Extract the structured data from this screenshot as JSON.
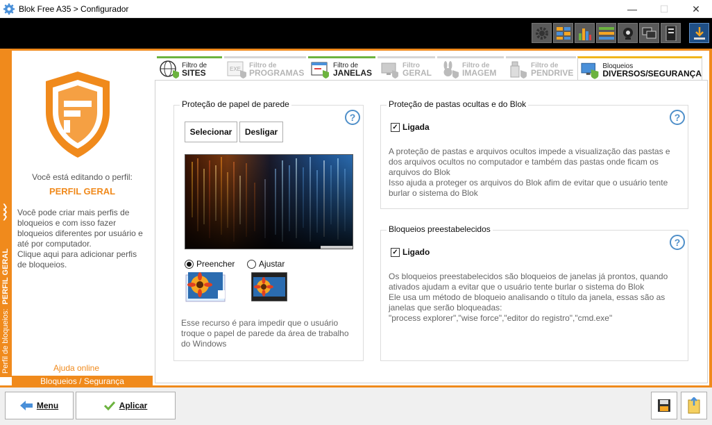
{
  "window": {
    "title": "Blok Free A35 > Configurador",
    "minimize": "—",
    "maximize": "☐",
    "close": "✕"
  },
  "toolbar": {
    "icons": [
      "settings-gear-icon",
      "grid-icon",
      "bar-chart-icon",
      "list-icon",
      "webcam-icon",
      "chat-icon",
      "device-icon",
      "download-icon"
    ]
  },
  "sidebar": {
    "vertical_label": "Perfil de bloqueios:",
    "vertical_profile": "PERFIL GERAL",
    "chevrons": "❯\n❯\n❯",
    "edit_label": "Você está editando o perfil:",
    "profile_name": "PERFIL GERAL",
    "description": "Você pode criar mais perfis de\nbloqueios e com isso fazer\nbloqueios diferentes por usuário e\naté por computador.\nClique aqui para adicionar perfis\nde bloqueios.",
    "help_online": "Ajuda online",
    "bottom_tab": "Bloqueios / Segurança"
  },
  "tabs": [
    {
      "small": "Filtro de",
      "big": "SITES"
    },
    {
      "small": "Filtro de",
      "big": "PROGRAMAS"
    },
    {
      "small": "Filtro de",
      "big": "JANELAS"
    },
    {
      "small": "Filtro",
      "big": "GERAL"
    },
    {
      "small": "Filtro de",
      "big": "IMAGEM"
    },
    {
      "small": "Filtro de",
      "big": "PENDRIVE"
    },
    {
      "small": "Bloqueios",
      "big": "DIVERSOS/SEGURANÇA"
    }
  ],
  "wallpaper": {
    "title": "Proteção de papel de parede",
    "help": "?",
    "select_label": "Selecionar",
    "disable_label": "Desligar",
    "fill_label": "Preencher",
    "fit_label": "Ajustar",
    "selected_mode": "Preencher",
    "note": "Esse recurso é para impedir que o usuário\ntroque o papel de parede da área de trabalho\ndo Windows"
  },
  "hidden_folders": {
    "title": "Proteção de pastas ocultas e do Blok",
    "help": "?",
    "check_label": "Ligada",
    "checked": true,
    "description": "A proteção de pastas e arquivos ocultos impede a visualização das pastas e\ndos arquivos ocultos no computador e também das pastas onde ficam os\narquivos do Blok\nIsso ajuda a proteger os arquivos do Blok afim de evitar que o usuário tente\nburlar o sistema do Blok"
  },
  "preset_blocks": {
    "title": "Bloqueios preestabelecidos",
    "help": "?",
    "check_label": "Ligado",
    "checked": true,
    "description": "Os bloqueios preestabelecidos são bloqueios de janelas já prontos, quando\nativados ajudam a evitar que o usuário tente burlar o sistema do Blok\nEle usa um método de bloqueio analisando o título da janela, essas são as\njanelas que serão bloqueadas:\n\"process explorer\",\"wise force\",\"editor do registro\",\"cmd.exe\""
  },
  "footer": {
    "menu_label": "Menu",
    "apply_label": "Aplicar",
    "check_mark": "✓"
  },
  "colors": {
    "accent": "#f08a1c",
    "active_tab": "#6cb33f",
    "selected_tab": "#f0b51c",
    "help_blue": "#4f8fc9"
  }
}
